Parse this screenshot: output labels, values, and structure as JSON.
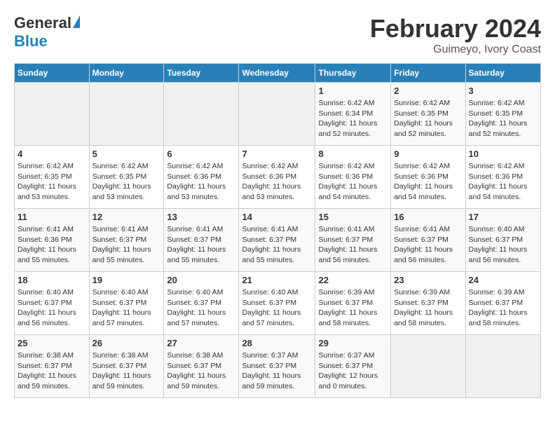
{
  "logo": {
    "general": "General",
    "blue": "Blue"
  },
  "title": "February 2024",
  "subtitle": "Guimeyo, Ivory Coast",
  "days_header": [
    "Sunday",
    "Monday",
    "Tuesday",
    "Wednesday",
    "Thursday",
    "Friday",
    "Saturday"
  ],
  "weeks": [
    [
      {
        "day": "",
        "info": ""
      },
      {
        "day": "",
        "info": ""
      },
      {
        "day": "",
        "info": ""
      },
      {
        "day": "",
        "info": ""
      },
      {
        "day": "1",
        "info": "Sunrise: 6:42 AM\nSunset: 6:34 PM\nDaylight: 11 hours\nand 52 minutes."
      },
      {
        "day": "2",
        "info": "Sunrise: 6:42 AM\nSunset: 6:35 PM\nDaylight: 11 hours\nand 52 minutes."
      },
      {
        "day": "3",
        "info": "Sunrise: 6:42 AM\nSunset: 6:35 PM\nDaylight: 11 hours\nand 52 minutes."
      }
    ],
    [
      {
        "day": "4",
        "info": "Sunrise: 6:42 AM\nSunset: 6:35 PM\nDaylight: 11 hours\nand 53 minutes."
      },
      {
        "day": "5",
        "info": "Sunrise: 6:42 AM\nSunset: 6:35 PM\nDaylight: 11 hours\nand 53 minutes."
      },
      {
        "day": "6",
        "info": "Sunrise: 6:42 AM\nSunset: 6:36 PM\nDaylight: 11 hours\nand 53 minutes."
      },
      {
        "day": "7",
        "info": "Sunrise: 6:42 AM\nSunset: 6:36 PM\nDaylight: 11 hours\nand 53 minutes."
      },
      {
        "day": "8",
        "info": "Sunrise: 6:42 AM\nSunset: 6:36 PM\nDaylight: 11 hours\nand 54 minutes."
      },
      {
        "day": "9",
        "info": "Sunrise: 6:42 AM\nSunset: 6:36 PM\nDaylight: 11 hours\nand 54 minutes."
      },
      {
        "day": "10",
        "info": "Sunrise: 6:42 AM\nSunset: 6:36 PM\nDaylight: 11 hours\nand 54 minutes."
      }
    ],
    [
      {
        "day": "11",
        "info": "Sunrise: 6:41 AM\nSunset: 6:36 PM\nDaylight: 11 hours\nand 55 minutes."
      },
      {
        "day": "12",
        "info": "Sunrise: 6:41 AM\nSunset: 6:37 PM\nDaylight: 11 hours\nand 55 minutes."
      },
      {
        "day": "13",
        "info": "Sunrise: 6:41 AM\nSunset: 6:37 PM\nDaylight: 11 hours\nand 55 minutes."
      },
      {
        "day": "14",
        "info": "Sunrise: 6:41 AM\nSunset: 6:37 PM\nDaylight: 11 hours\nand 55 minutes."
      },
      {
        "day": "15",
        "info": "Sunrise: 6:41 AM\nSunset: 6:37 PM\nDaylight: 11 hours\nand 56 minutes."
      },
      {
        "day": "16",
        "info": "Sunrise: 6:41 AM\nSunset: 6:37 PM\nDaylight: 11 hours\nand 56 minutes."
      },
      {
        "day": "17",
        "info": "Sunrise: 6:40 AM\nSunset: 6:37 PM\nDaylight: 11 hours\nand 56 minutes."
      }
    ],
    [
      {
        "day": "18",
        "info": "Sunrise: 6:40 AM\nSunset: 6:37 PM\nDaylight: 11 hours\nand 56 minutes."
      },
      {
        "day": "19",
        "info": "Sunrise: 6:40 AM\nSunset: 6:37 PM\nDaylight: 11 hours\nand 57 minutes."
      },
      {
        "day": "20",
        "info": "Sunrise: 6:40 AM\nSunset: 6:37 PM\nDaylight: 11 hours\nand 57 minutes."
      },
      {
        "day": "21",
        "info": "Sunrise: 6:40 AM\nSunset: 6:37 PM\nDaylight: 11 hours\nand 57 minutes."
      },
      {
        "day": "22",
        "info": "Sunrise: 6:39 AM\nSunset: 6:37 PM\nDaylight: 11 hours\nand 58 minutes."
      },
      {
        "day": "23",
        "info": "Sunrise: 6:39 AM\nSunset: 6:37 PM\nDaylight: 11 hours\nand 58 minutes."
      },
      {
        "day": "24",
        "info": "Sunrise: 6:39 AM\nSunset: 6:37 PM\nDaylight: 11 hours\nand 58 minutes."
      }
    ],
    [
      {
        "day": "25",
        "info": "Sunrise: 6:38 AM\nSunset: 6:37 PM\nDaylight: 11 hours\nand 59 minutes."
      },
      {
        "day": "26",
        "info": "Sunrise: 6:38 AM\nSunset: 6:37 PM\nDaylight: 11 hours\nand 59 minutes."
      },
      {
        "day": "27",
        "info": "Sunrise: 6:38 AM\nSunset: 6:37 PM\nDaylight: 11 hours\nand 59 minutes."
      },
      {
        "day": "28",
        "info": "Sunrise: 6:37 AM\nSunset: 6:37 PM\nDaylight: 11 hours\nand 59 minutes."
      },
      {
        "day": "29",
        "info": "Sunrise: 6:37 AM\nSunset: 6:37 PM\nDaylight: 12 hours\nand 0 minutes."
      },
      {
        "day": "",
        "info": ""
      },
      {
        "day": "",
        "info": ""
      }
    ]
  ]
}
